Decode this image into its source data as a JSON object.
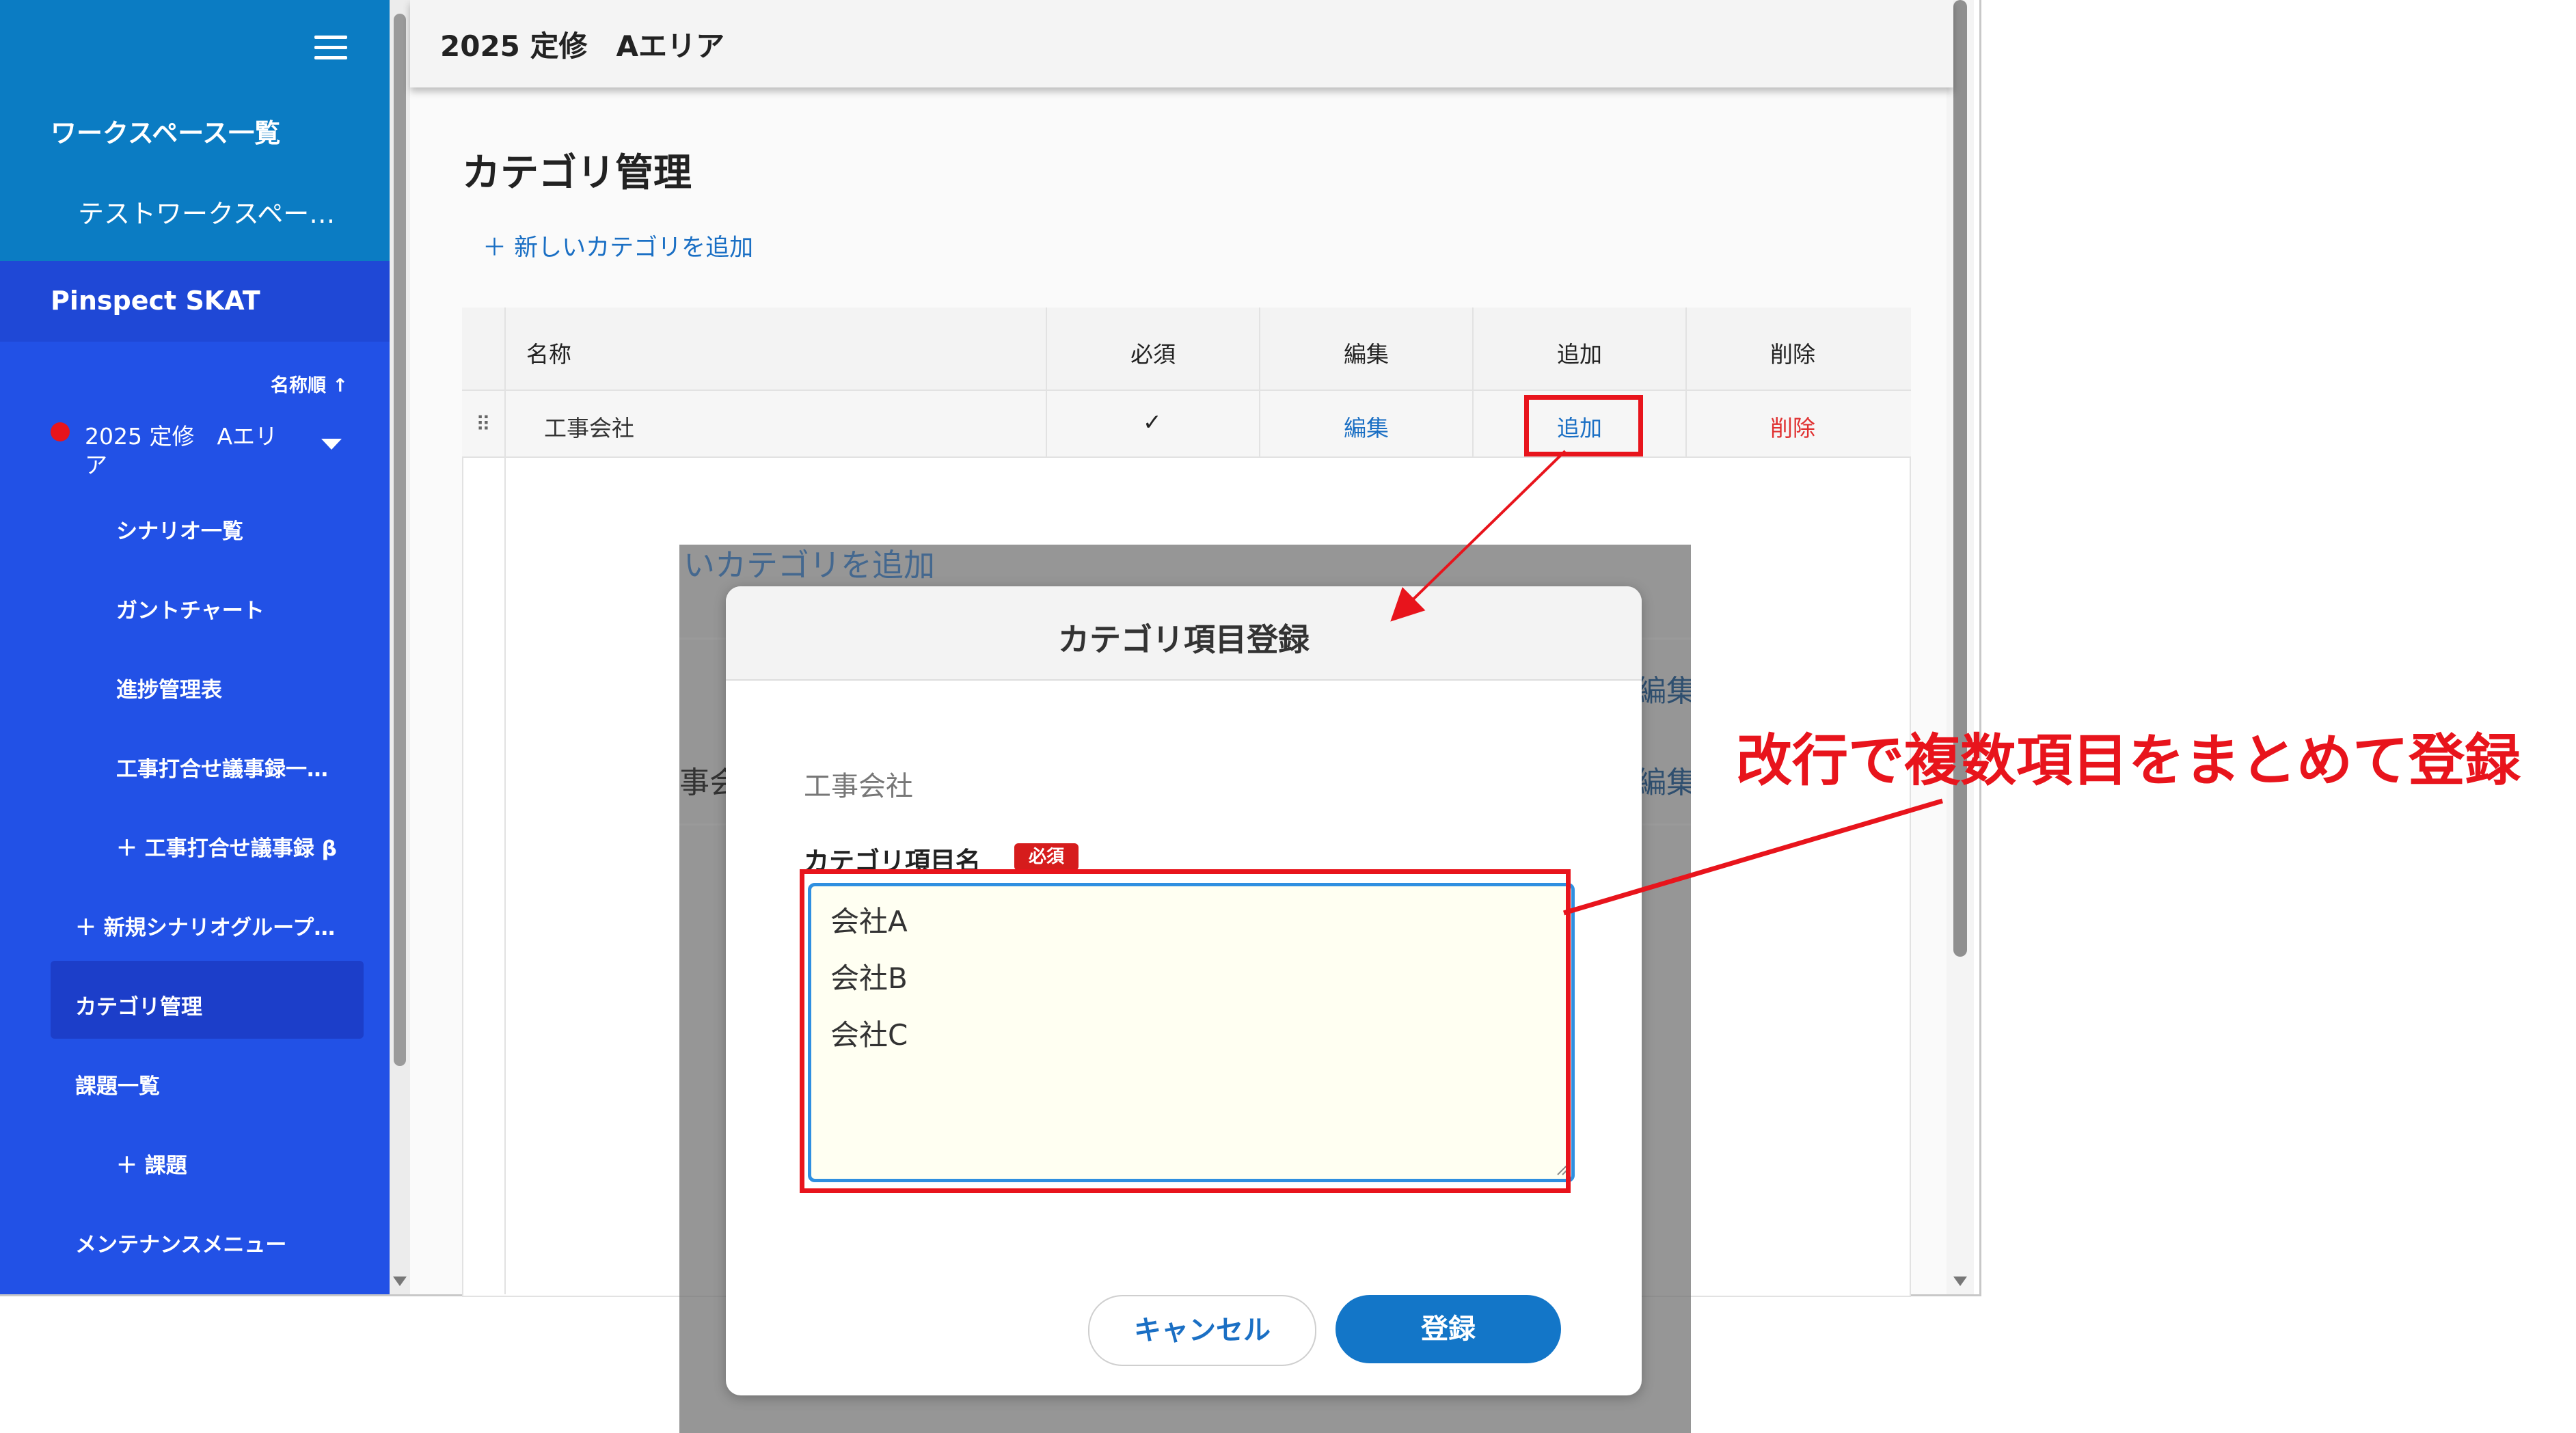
{
  "sidebar": {
    "workspace_list": "ワークスペース一覧",
    "workspace_item": "テストワークスペー…",
    "app_name": "Pinspect SKAT",
    "sort_label": "名称順 ↑",
    "project_line1": "2025 定修　Aエリ",
    "project_line2": "ア",
    "items": [
      {
        "label": "シナリオ一覧"
      },
      {
        "label": "ガントチャート"
      },
      {
        "label": "進捗管理表"
      },
      {
        "label": "工事打合せ議事録一…"
      },
      {
        "label": "＋ 工事打合せ議事録 β"
      },
      {
        "label": "＋ 新規シナリオグループ…"
      },
      {
        "label": "カテゴリ管理"
      },
      {
        "label": "課題一覧"
      },
      {
        "label": "＋ 課題"
      },
      {
        "label": "メンテナンスメニュー"
      }
    ]
  },
  "header": {
    "title": "2025 定修　Aエリア"
  },
  "page": {
    "title": "カテゴリ管理",
    "add_category": "＋ 新しいカテゴリを追加"
  },
  "table": {
    "columns": [
      "名称",
      "必須",
      "編集",
      "追加",
      "削除"
    ],
    "rows": [
      {
        "name": "工事会社",
        "required": "✓",
        "edit": "編集",
        "add": "追加",
        "delete": "削除"
      }
    ]
  },
  "background_fragments": {
    "add_category": "いカテゴリを追加",
    "edit1": "編集",
    "name1": "事会",
    "edit2": "編集"
  },
  "modal": {
    "title": "カテゴリ項目登録",
    "category": "工事会社",
    "field_label": "カテゴリ項目名",
    "required_badge": "必須",
    "lines": [
      "会社A",
      "会社B",
      "会社C"
    ],
    "cancel": "キャンセル",
    "submit": "登録"
  },
  "annotation": {
    "text": "改行で複数項目をまとめて登録"
  },
  "colors": {
    "sidebar": "#2251e6",
    "workspace_bg": "#0b7cc3",
    "link": "#1a6fc4",
    "danger": "#e03030",
    "annotation": "#e8141c",
    "primary_button": "#1376c8"
  }
}
